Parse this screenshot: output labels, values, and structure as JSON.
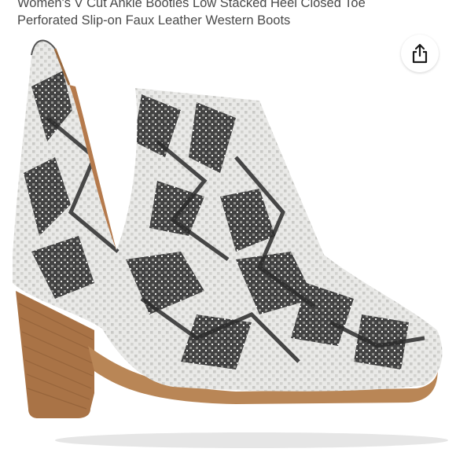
{
  "product": {
    "title_line1": "Women's V Cut Ankle Booties Low Stacked Heel Closed Toe",
    "title_line2": "Perforated Slip-on Faux Leather Western Boots"
  },
  "share_button": {
    "icon": "share-icon"
  },
  "image": {
    "subject": "snakeskin-ankle-boot"
  },
  "colors": {
    "title_text": "#4a4a4a",
    "scale_light": "#e9e9e7",
    "scale_dark": "#2b2b2b",
    "sole": "#b98656",
    "heel": "#a97346"
  }
}
